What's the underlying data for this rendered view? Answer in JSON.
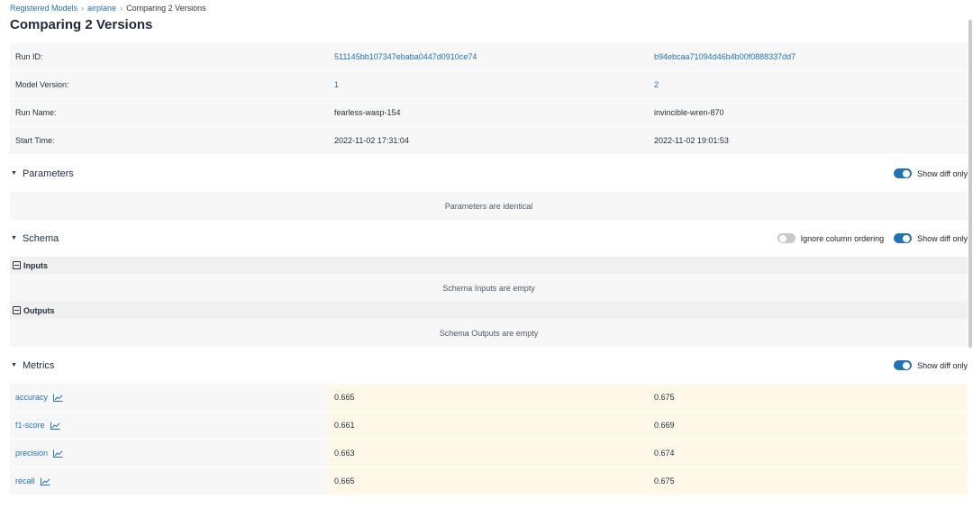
{
  "breadcrumb": {
    "registered_models": "Registered Models",
    "model": "airplane",
    "current": "Comparing 2 Versions",
    "separator": "›"
  },
  "page_title": "Comparing 2 Versions",
  "info": {
    "run_id": {
      "label": "Run ID:",
      "v1": "511145bb107347ebaba0447d0910ce74",
      "v2": "b94ebcaa71094d46b4b00f0888337dd7"
    },
    "model_version": {
      "label": "Model Version:",
      "v1": "1",
      "v2": "2"
    },
    "run_name": {
      "label": "Run Name:",
      "v1": "fearless-wasp-154",
      "v2": "invincible-wren-870"
    },
    "start_time": {
      "label": "Start Time:",
      "v1": "2022-11-02 17:31:04",
      "v2": "2022-11-02 19:01:53"
    }
  },
  "parameters": {
    "title": "Parameters",
    "show_diff_label": "Show diff only",
    "show_diff_on": true,
    "empty_text": "Parameters are identical"
  },
  "schema": {
    "title": "Schema",
    "ignore_ordering_label": "Ignore column ordering",
    "ignore_ordering_on": false,
    "show_diff_label": "Show diff only",
    "show_diff_on": true,
    "inputs_label": "Inputs",
    "inputs_empty": "Schema Inputs are empty",
    "outputs_label": "Outputs",
    "outputs_empty": "Schema Outputs are empty"
  },
  "metrics": {
    "title": "Metrics",
    "show_diff_label": "Show diff only",
    "show_diff_on": true,
    "rows": [
      {
        "name": "accuracy",
        "v1": "0.665",
        "v2": "0.675"
      },
      {
        "name": "f1-score",
        "v1": "0.661",
        "v2": "0.669"
      },
      {
        "name": "precision",
        "v1": "0.663",
        "v2": "0.674"
      },
      {
        "name": "recall",
        "v1": "0.665",
        "v2": "0.675"
      }
    ]
  },
  "colors": {
    "link": "#2272b4",
    "toggle_on": "#2272b4",
    "toggle_off": "#c9c9c9",
    "diff_highlight": "#fdf8e8",
    "row_bg": "#f7f7f7"
  }
}
